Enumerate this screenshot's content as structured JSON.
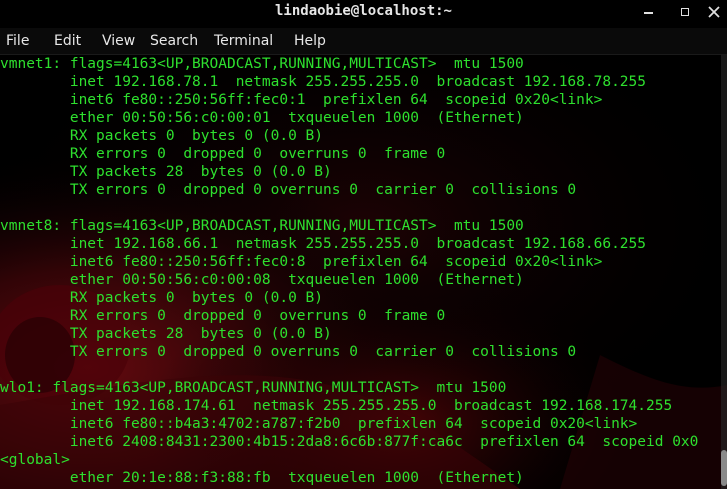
{
  "window": {
    "title": "lindaobie@localhost:~",
    "buttons": {
      "minimize_icon": "minimize-icon",
      "maximize_icon": "maximize-icon",
      "close_icon": "close-icon"
    }
  },
  "menu": {
    "items": [
      "File",
      "Edit",
      "View",
      "Search",
      "Terminal",
      "Help"
    ]
  },
  "terminal": {
    "text_color": "#2ee02e",
    "background_color": "#000000",
    "lines": [
      "vmnet1: flags=4163<UP,BROADCAST,RUNNING,MULTICAST>  mtu 1500",
      "        inet 192.168.78.1  netmask 255.255.255.0  broadcast 192.168.78.255",
      "        inet6 fe80::250:56ff:fec0:1  prefixlen 64  scopeid 0x20<link>",
      "        ether 00:50:56:c0:00:01  txqueuelen 1000  (Ethernet)",
      "        RX packets 0  bytes 0 (0.0 B)",
      "        RX errors 0  dropped 0  overruns 0  frame 0",
      "        TX packets 28  bytes 0 (0.0 B)",
      "        TX errors 0  dropped 0 overruns 0  carrier 0  collisions 0",
      "",
      "vmnet8: flags=4163<UP,BROADCAST,RUNNING,MULTICAST>  mtu 1500",
      "        inet 192.168.66.1  netmask 255.255.255.0  broadcast 192.168.66.255",
      "        inet6 fe80::250:56ff:fec0:8  prefixlen 64  scopeid 0x20<link>",
      "        ether 00:50:56:c0:00:08  txqueuelen 1000  (Ethernet)",
      "        RX packets 0  bytes 0 (0.0 B)",
      "        RX errors 0  dropped 0  overruns 0  frame 0",
      "        TX packets 28  bytes 0 (0.0 B)",
      "        TX errors 0  dropped 0 overruns 0  carrier 0  collisions 0",
      "",
      "wlo1: flags=4163<UP,BROADCAST,RUNNING,MULTICAST>  mtu 1500",
      "        inet 192.168.174.61  netmask 255.255.255.0  broadcast 192.168.174.255",
      "        inet6 fe80::b4a3:4702:a787:f2b0  prefixlen 64  scopeid 0x20<link>",
      "        inet6 2408:8431:2300:4b15:2da8:6c6b:877f:ca6c  prefixlen 64  scopeid 0x0",
      "<global>",
      "        ether 20:1e:88:f3:88:fb  txqueuelen 1000  (Ethernet)"
    ]
  }
}
